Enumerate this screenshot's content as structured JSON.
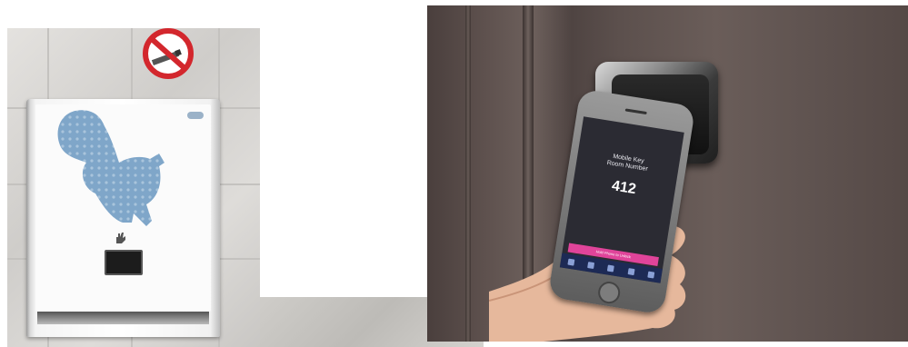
{
  "left_photo": {
    "colors": {
      "tile": "#d9d7d4",
      "squirrel": "#7fa6c9",
      "sign_red": "#d3272d"
    },
    "icons": [
      "no-smoking-icon",
      "squirrel-graphic",
      "hand-sensor-icon"
    ]
  },
  "right_photo": {
    "phone_screen": {
      "title": "Mobile Key",
      "subtitle": "Room Number",
      "room_number": "412",
      "unlock_label": "Hold Phone to Unlock"
    },
    "colors": {
      "door": "#5e514e",
      "accent": "#e0449a",
      "tab_bar": "#1d2a55"
    }
  }
}
